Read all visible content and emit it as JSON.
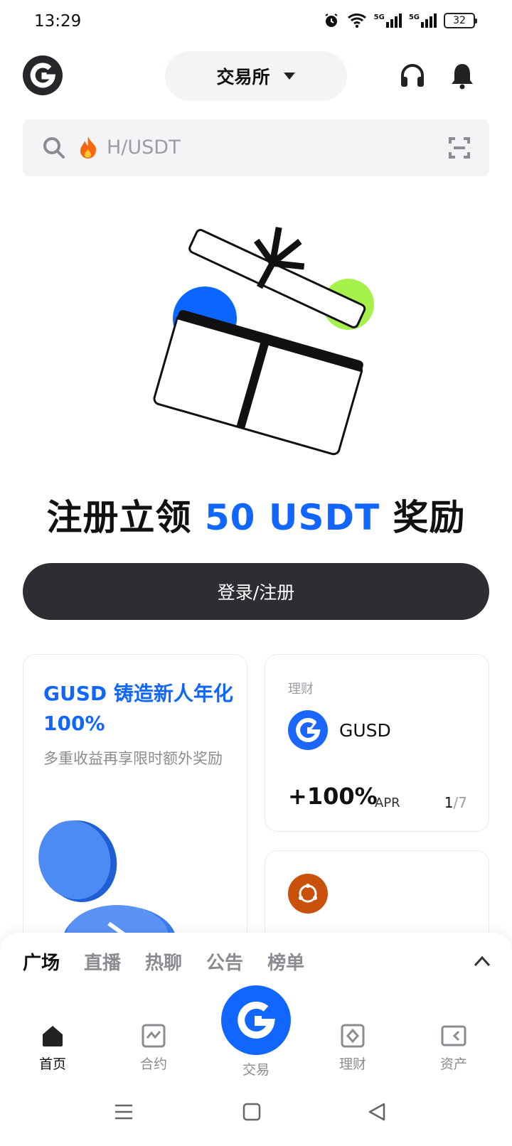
{
  "status_bar": {
    "time": "13:29",
    "network_1": "5G",
    "network_2": "5G",
    "battery": "32"
  },
  "header": {
    "exchange_tab_label": "交易所",
    "icons": [
      "app-logo-icon",
      "headset-icon",
      "bell-icon",
      "chevron-down-icon"
    ]
  },
  "search": {
    "placeholder": "H/USDT",
    "icons": [
      "search-icon",
      "fire-icon",
      "scan-icon"
    ]
  },
  "hero": {
    "title_prefix": "注册立领",
    "title_accent": "50 USDT",
    "title_suffix": "奖励",
    "login_button": "登录/注册"
  },
  "promo_card": {
    "title": "GUSD 铸造新人年化 100%",
    "subtitle": "多重收益再享限时额外奖励"
  },
  "earn_card": {
    "tag": "理财",
    "coin": "GUSD",
    "apr_value": "+100%",
    "apr_label": "APR",
    "page_current": "1",
    "page_total": "/7"
  },
  "feed_tabs": [
    "广场",
    "直播",
    "热聊",
    "公告",
    "榜单"
  ],
  "bottom_nav": {
    "home": "首页",
    "futures": "合约",
    "trade": "交易",
    "earn": "理财",
    "assets": "资产"
  },
  "colors": {
    "accent": "#1166ff",
    "dark_button": "#2d2e33",
    "muted_text": "#8a8c92",
    "green_ball": "#a6f24a"
  }
}
